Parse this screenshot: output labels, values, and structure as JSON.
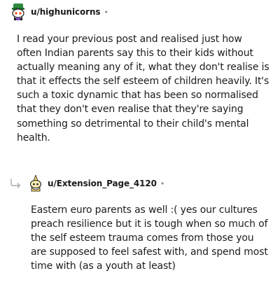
{
  "top_comment": {
    "username": "u/highunicorns",
    "separator": "•",
    "avatar_icon": "unicorn-snoo-avatar-icon",
    "body_lines": [
      "I read your previous post and realised just how",
      "often Indian parents say this to their kids without",
      "actually meaning any of it, what they don't realise is",
      "that it effects the self esteem of children heavily. It's",
      "such a toxic dynamic that has been so normalised",
      "that they don't even realise that they're saying",
      "something so detrimental to their child's mental",
      "health."
    ]
  },
  "reply_comment": {
    "username": "u/Extension_Page_4120",
    "separator": "•",
    "avatar_icon": "snoo-with-hat-avatar-icon",
    "reply_indicator_icon": "reply-arrow-icon",
    "body_lines": [
      "Eastern euro parents as well :( yes our cultures",
      "preach resilience but it is tough when so much of",
      "the self esteem trauma comes from those you",
      "are supposed to feel safest with, and spend most",
      "time with (as a youth at least)"
    ]
  },
  "colors": {
    "text": "#1c1c1c",
    "muted": "#878a8c",
    "background": "#ffffff"
  }
}
